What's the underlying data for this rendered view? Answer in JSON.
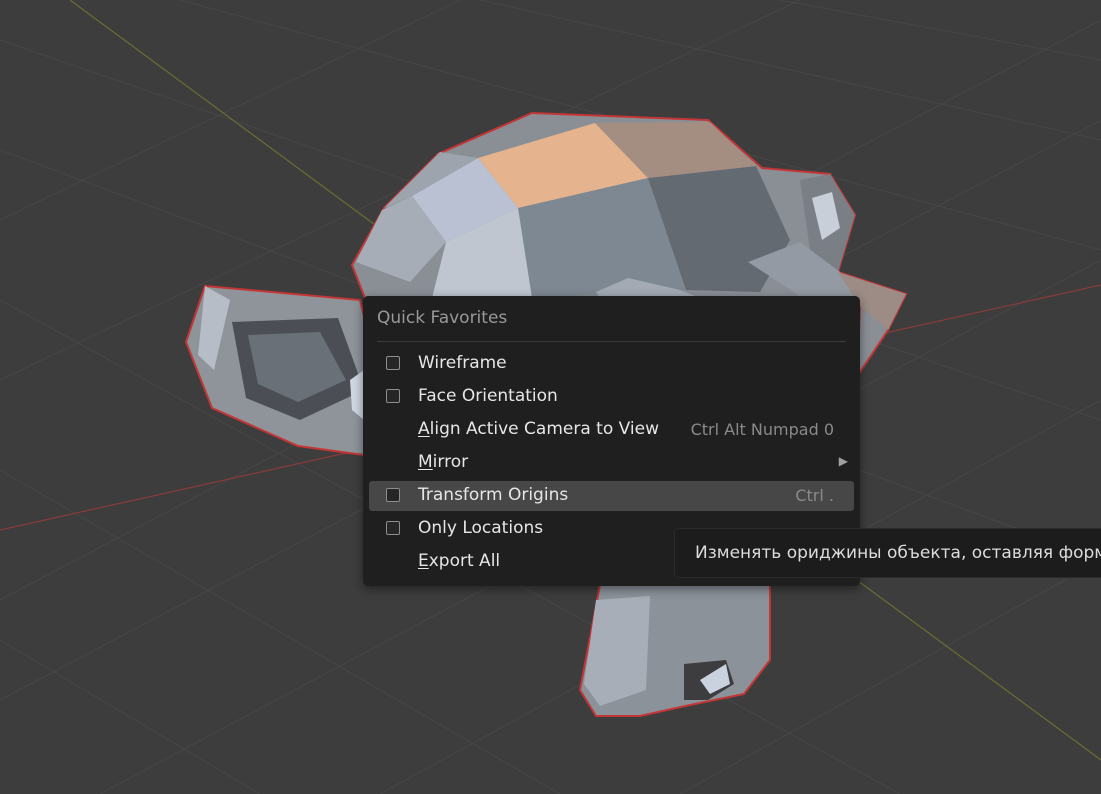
{
  "viewport": {
    "background": "#3d3d3d",
    "grid_color": "#474747",
    "x_axis_color": "#8a3a3a",
    "y_axis_color": "#6d6d32",
    "selection_outline": "#c43636"
  },
  "menu": {
    "title": "Quick Favorites",
    "items": [
      {
        "label_pre": "",
        "label_key": "",
        "label_post": "Wireframe",
        "shortcut": "",
        "checkbox": true,
        "checked": false,
        "submenu": false,
        "highlighted": false
      },
      {
        "label_pre": "",
        "label_key": "",
        "label_post": "Face Orientation",
        "shortcut": "",
        "checkbox": true,
        "checked": false,
        "submenu": false,
        "highlighted": false
      },
      {
        "label_pre": "",
        "label_key": "A",
        "label_post": "lign Active Camera to View",
        "shortcut": "Ctrl Alt Numpad 0",
        "checkbox": false,
        "checked": false,
        "submenu": false,
        "highlighted": false
      },
      {
        "label_pre": "",
        "label_key": "M",
        "label_post": "irror",
        "shortcut": "",
        "checkbox": false,
        "checked": false,
        "submenu": true,
        "highlighted": false
      },
      {
        "label_pre": "",
        "label_key": "",
        "label_post": "Transform Origins",
        "shortcut": "Ctrl .",
        "checkbox": true,
        "checked": false,
        "submenu": false,
        "highlighted": true
      },
      {
        "label_pre": "",
        "label_key": "",
        "label_post": "Only Locations",
        "shortcut": "",
        "checkbox": true,
        "checked": false,
        "submenu": false,
        "highlighted": false
      },
      {
        "label_pre": "",
        "label_key": "E",
        "label_post": "xport All",
        "shortcut": "",
        "checkbox": false,
        "checked": false,
        "submenu": false,
        "highlighted": false
      }
    ],
    "submenu_arrow": "▶"
  },
  "tooltip": {
    "text": "Изменять ориджины объекта, оставляя форму неизменной"
  }
}
